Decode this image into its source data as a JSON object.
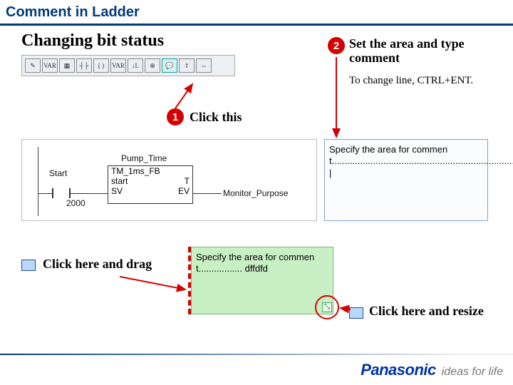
{
  "header": {
    "title": "Comment in Ladder"
  },
  "subtitle": "Changing bit status",
  "toolbar": {
    "buttons": [
      {
        "name": "edit-icon",
        "glyph": "✎"
      },
      {
        "name": "var-icon",
        "glyph": "VAR"
      },
      {
        "name": "fb-icon",
        "glyph": "▦"
      },
      {
        "name": "contact-icon",
        "glyph": "┤├"
      },
      {
        "name": "coil-icon",
        "glyph": "( )"
      },
      {
        "name": "var2-icon",
        "glyph": "VAR"
      },
      {
        "name": "l-icon",
        "glyph": "↓L"
      },
      {
        "name": "plus-icon",
        "glyph": "⊕"
      },
      {
        "name": "comment-icon",
        "glyph": "💬"
      },
      {
        "name": "up-icon",
        "glyph": "⇧"
      },
      {
        "name": "swap-icon",
        "glyph": "⇔"
      }
    ],
    "active_index": 8
  },
  "step1": {
    "num": "1",
    "label": "Click this"
  },
  "step2": {
    "num": "2",
    "label": "Set the area and type comment",
    "note": "To change line, CTRL+ENT."
  },
  "ladder": {
    "contact_label": "Start",
    "contact_addr": "2000",
    "block_title": "Pump_Time",
    "block_rows": [
      [
        "TM_1ms_FB",
        ""
      ],
      [
        "start",
        "T"
      ],
      [
        "SV",
        "EV"
      ]
    ],
    "output_label": "Monitor_Purpose"
  },
  "comment_area": {
    "text": "Specify the area for comment......................................................................................................................|"
  },
  "drag": {
    "label": "Click here and drag"
  },
  "greenbox": {
    "text": "Specify the area for comment................. dffdfd"
  },
  "resize": {
    "label": "Click here and resize"
  },
  "brand": {
    "name": "Panasonic",
    "tagline": "ideas for life"
  }
}
